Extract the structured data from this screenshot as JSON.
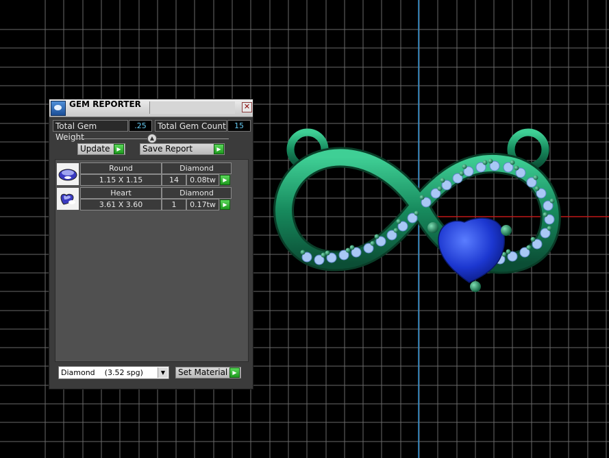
{
  "panel": {
    "title": "GEM REPORTER",
    "close_glyph": "✕",
    "total_weight_label": "Total Gem Weight",
    "total_weight_value": ".25",
    "total_count_label": "Total Gem Count",
    "total_count_value": "15",
    "update_label": "Update",
    "save_report_label": "Save Report",
    "arrow_glyph": "▶",
    "gems": [
      {
        "shape": "Round",
        "material": "Diamond",
        "size": "1.15 X 1.15",
        "count": "14",
        "weight": "0.08tw",
        "icon": "round-gem-icon"
      },
      {
        "shape": "Heart",
        "material": "Diamond",
        "size": "3.61 X 3.60",
        "count": "1",
        "weight": "0.17tw",
        "icon": "heart-gem-icon"
      }
    ],
    "material_select": {
      "selected": "Diamond    (3.52 spg)"
    },
    "set_material_label": "Set Material"
  },
  "colors": {
    "background": "#000000",
    "grid": "#6a6a6a",
    "axis_vertical": "#2f8fd0",
    "axis_horizontal": "#c01818",
    "metal": "#1f9a6a",
    "small_stones": "#a9c8f5",
    "heart_stone": "#1b3fd6",
    "value_text": "#64c8f0"
  }
}
